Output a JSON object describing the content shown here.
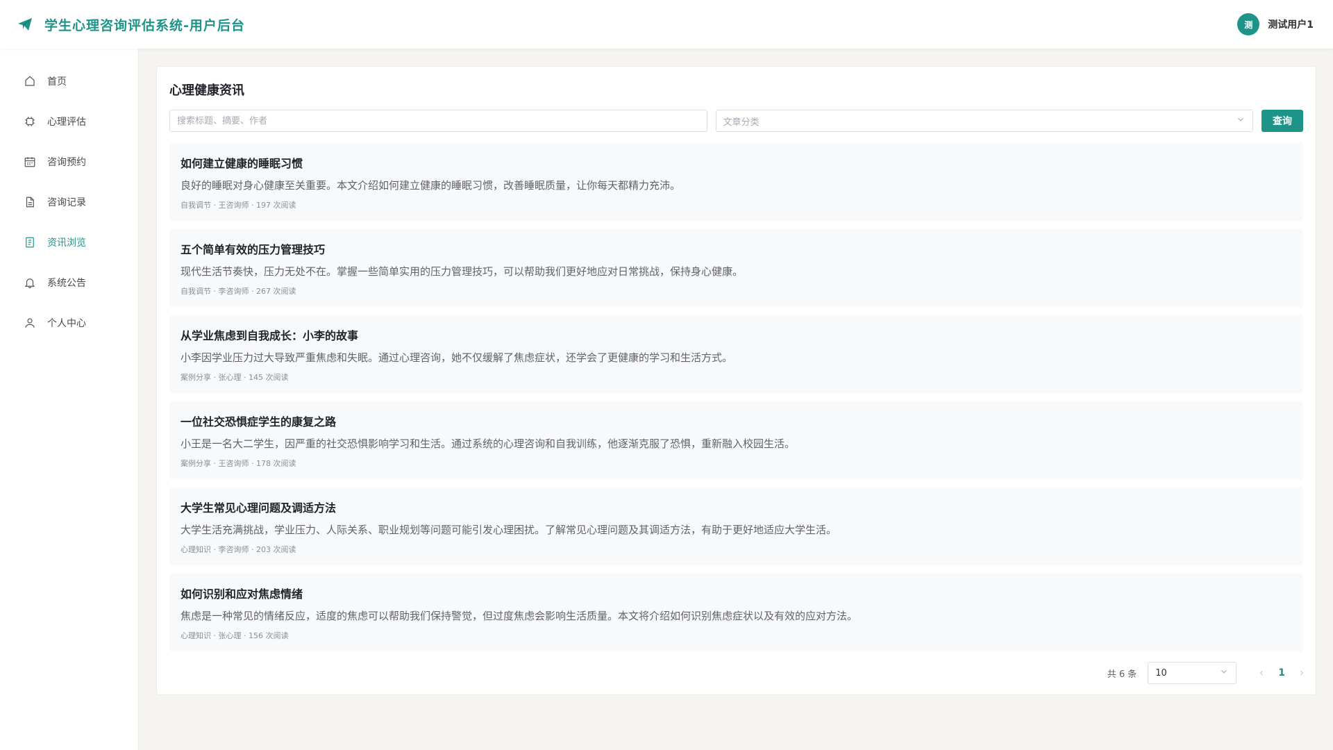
{
  "header": {
    "title": "学生心理咨询评估系统-用户后台",
    "user_avatar_text": "测",
    "user_name": "测试用户1"
  },
  "sidebar": {
    "items": [
      {
        "label": "首页",
        "icon": "home-icon"
      },
      {
        "label": "心理评估",
        "icon": "chip-icon"
      },
      {
        "label": "咨询预约",
        "icon": "calendar-icon"
      },
      {
        "label": "咨询记录",
        "icon": "document-icon"
      },
      {
        "label": "资讯浏览",
        "icon": "news-icon",
        "active": true
      },
      {
        "label": "系统公告",
        "icon": "bell-icon"
      },
      {
        "label": "个人中心",
        "icon": "user-icon"
      }
    ]
  },
  "main": {
    "title": "心理健康资讯",
    "search_placeholder": "搜索标题、摘要、作者",
    "category_placeholder": "文章分类",
    "query_label": "查询",
    "articles": [
      {
        "title": "如何建立健康的睡眠习惯",
        "summary": "良好的睡眠对身心健康至关重要。本文介绍如何建立健康的睡眠习惯，改善睡眠质量，让你每天都精力充沛。",
        "meta": "自我调节 · 王咨询师 · 197 次阅读"
      },
      {
        "title": "五个简单有效的压力管理技巧",
        "summary": "现代生活节奏快，压力无处不在。掌握一些简单实用的压力管理技巧，可以帮助我们更好地应对日常挑战，保持身心健康。",
        "meta": "自我调节 · 李咨询师 · 267 次阅读"
      },
      {
        "title": "从学业焦虑到自我成长：小李的故事",
        "summary": "小李因学业压力过大导致严重焦虑和失眠。通过心理咨询，她不仅缓解了焦虑症状，还学会了更健康的学习和生活方式。",
        "meta": "案例分享 · 张心理 · 145 次阅读"
      },
      {
        "title": "一位社交恐惧症学生的康复之路",
        "summary": "小王是一名大二学生，因严重的社交恐惧影响学习和生活。通过系统的心理咨询和自我训练，他逐渐克服了恐惧，重新融入校园生活。",
        "meta": "案例分享 · 王咨询师 · 178 次阅读"
      },
      {
        "title": "大学生常见心理问题及调适方法",
        "summary": "大学生活充满挑战，学业压力、人际关系、职业规划等问题可能引发心理困扰。了解常见心理问题及其调适方法，有助于更好地适应大学生活。",
        "meta": "心理知识 · 李咨询师 · 203 次阅读"
      },
      {
        "title": "如何识别和应对焦虑情绪",
        "summary": "焦虑是一种常见的情绪反应，适度的焦虑可以帮助我们保持警觉，但过度焦虑会影响生活质量。本文将介绍如何识别焦虑症状以及有效的应对方法。",
        "meta": "心理知识 · 张心理 · 156 次阅读"
      }
    ]
  },
  "pagination": {
    "total_text": "共 6 条",
    "page_size": "10",
    "current_page": "1"
  },
  "colors": {
    "accent": "#1e9488",
    "background": "#f5f4f1"
  }
}
